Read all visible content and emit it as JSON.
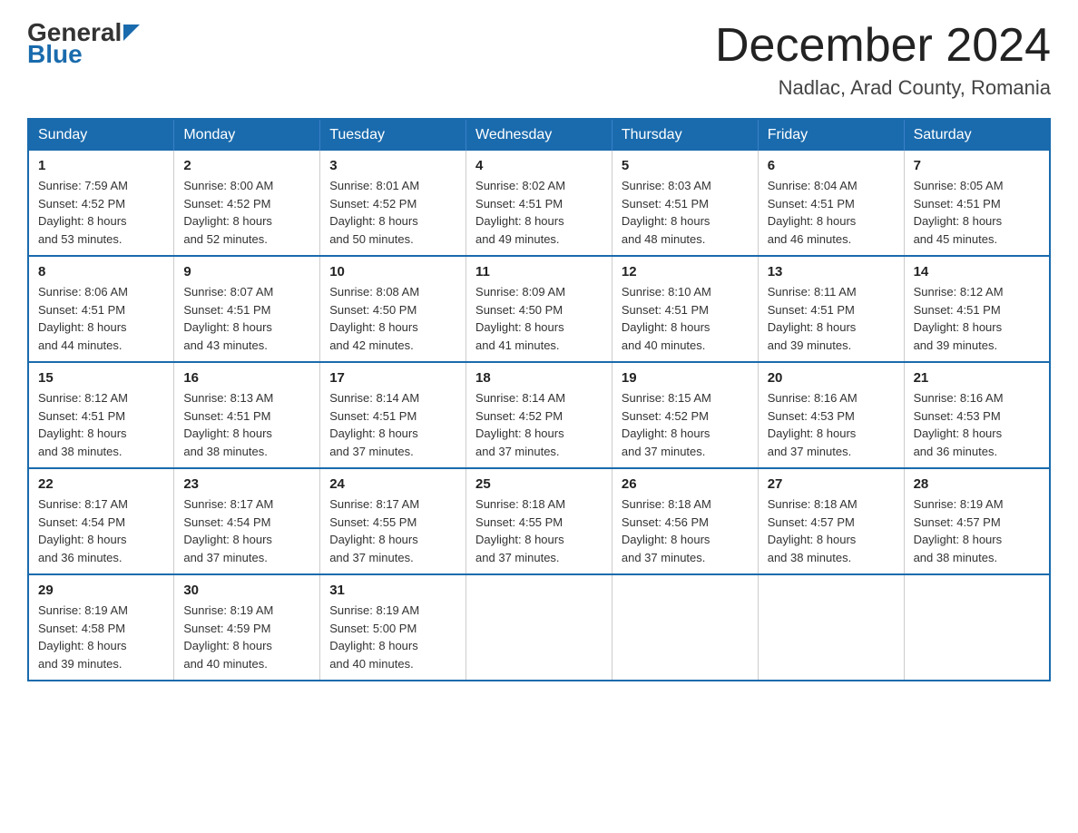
{
  "header": {
    "logo_general": "General",
    "logo_blue": "Blue",
    "month_title": "December 2024",
    "location": "Nadlac, Arad County, Romania"
  },
  "days_of_week": [
    "Sunday",
    "Monday",
    "Tuesday",
    "Wednesday",
    "Thursday",
    "Friday",
    "Saturday"
  ],
  "weeks": [
    [
      {
        "day": "1",
        "sunrise": "7:59 AM",
        "sunset": "4:52 PM",
        "daylight": "8 hours and 53 minutes."
      },
      {
        "day": "2",
        "sunrise": "8:00 AM",
        "sunset": "4:52 PM",
        "daylight": "8 hours and 52 minutes."
      },
      {
        "day": "3",
        "sunrise": "8:01 AM",
        "sunset": "4:52 PM",
        "daylight": "8 hours and 50 minutes."
      },
      {
        "day": "4",
        "sunrise": "8:02 AM",
        "sunset": "4:51 PM",
        "daylight": "8 hours and 49 minutes."
      },
      {
        "day": "5",
        "sunrise": "8:03 AM",
        "sunset": "4:51 PM",
        "daylight": "8 hours and 48 minutes."
      },
      {
        "day": "6",
        "sunrise": "8:04 AM",
        "sunset": "4:51 PM",
        "daylight": "8 hours and 46 minutes."
      },
      {
        "day": "7",
        "sunrise": "8:05 AM",
        "sunset": "4:51 PM",
        "daylight": "8 hours and 45 minutes."
      }
    ],
    [
      {
        "day": "8",
        "sunrise": "8:06 AM",
        "sunset": "4:51 PM",
        "daylight": "8 hours and 44 minutes."
      },
      {
        "day": "9",
        "sunrise": "8:07 AM",
        "sunset": "4:51 PM",
        "daylight": "8 hours and 43 minutes."
      },
      {
        "day": "10",
        "sunrise": "8:08 AM",
        "sunset": "4:50 PM",
        "daylight": "8 hours and 42 minutes."
      },
      {
        "day": "11",
        "sunrise": "8:09 AM",
        "sunset": "4:50 PM",
        "daylight": "8 hours and 41 minutes."
      },
      {
        "day": "12",
        "sunrise": "8:10 AM",
        "sunset": "4:51 PM",
        "daylight": "8 hours and 40 minutes."
      },
      {
        "day": "13",
        "sunrise": "8:11 AM",
        "sunset": "4:51 PM",
        "daylight": "8 hours and 39 minutes."
      },
      {
        "day": "14",
        "sunrise": "8:12 AM",
        "sunset": "4:51 PM",
        "daylight": "8 hours and 39 minutes."
      }
    ],
    [
      {
        "day": "15",
        "sunrise": "8:12 AM",
        "sunset": "4:51 PM",
        "daylight": "8 hours and 38 minutes."
      },
      {
        "day": "16",
        "sunrise": "8:13 AM",
        "sunset": "4:51 PM",
        "daylight": "8 hours and 38 minutes."
      },
      {
        "day": "17",
        "sunrise": "8:14 AM",
        "sunset": "4:51 PM",
        "daylight": "8 hours and 37 minutes."
      },
      {
        "day": "18",
        "sunrise": "8:14 AM",
        "sunset": "4:52 PM",
        "daylight": "8 hours and 37 minutes."
      },
      {
        "day": "19",
        "sunrise": "8:15 AM",
        "sunset": "4:52 PM",
        "daylight": "8 hours and 37 minutes."
      },
      {
        "day": "20",
        "sunrise": "8:16 AM",
        "sunset": "4:53 PM",
        "daylight": "8 hours and 37 minutes."
      },
      {
        "day": "21",
        "sunrise": "8:16 AM",
        "sunset": "4:53 PM",
        "daylight": "8 hours and 36 minutes."
      }
    ],
    [
      {
        "day": "22",
        "sunrise": "8:17 AM",
        "sunset": "4:54 PM",
        "daylight": "8 hours and 36 minutes."
      },
      {
        "day": "23",
        "sunrise": "8:17 AM",
        "sunset": "4:54 PM",
        "daylight": "8 hours and 37 minutes."
      },
      {
        "day": "24",
        "sunrise": "8:17 AM",
        "sunset": "4:55 PM",
        "daylight": "8 hours and 37 minutes."
      },
      {
        "day": "25",
        "sunrise": "8:18 AM",
        "sunset": "4:55 PM",
        "daylight": "8 hours and 37 minutes."
      },
      {
        "day": "26",
        "sunrise": "8:18 AM",
        "sunset": "4:56 PM",
        "daylight": "8 hours and 37 minutes."
      },
      {
        "day": "27",
        "sunrise": "8:18 AM",
        "sunset": "4:57 PM",
        "daylight": "8 hours and 38 minutes."
      },
      {
        "day": "28",
        "sunrise": "8:19 AM",
        "sunset": "4:57 PM",
        "daylight": "8 hours and 38 minutes."
      }
    ],
    [
      {
        "day": "29",
        "sunrise": "8:19 AM",
        "sunset": "4:58 PM",
        "daylight": "8 hours and 39 minutes."
      },
      {
        "day": "30",
        "sunrise": "8:19 AM",
        "sunset": "4:59 PM",
        "daylight": "8 hours and 40 minutes."
      },
      {
        "day": "31",
        "sunrise": "8:19 AM",
        "sunset": "5:00 PM",
        "daylight": "8 hours and 40 minutes."
      },
      null,
      null,
      null,
      null
    ]
  ],
  "labels": {
    "sunrise": "Sunrise:",
    "sunset": "Sunset:",
    "daylight": "Daylight:"
  }
}
